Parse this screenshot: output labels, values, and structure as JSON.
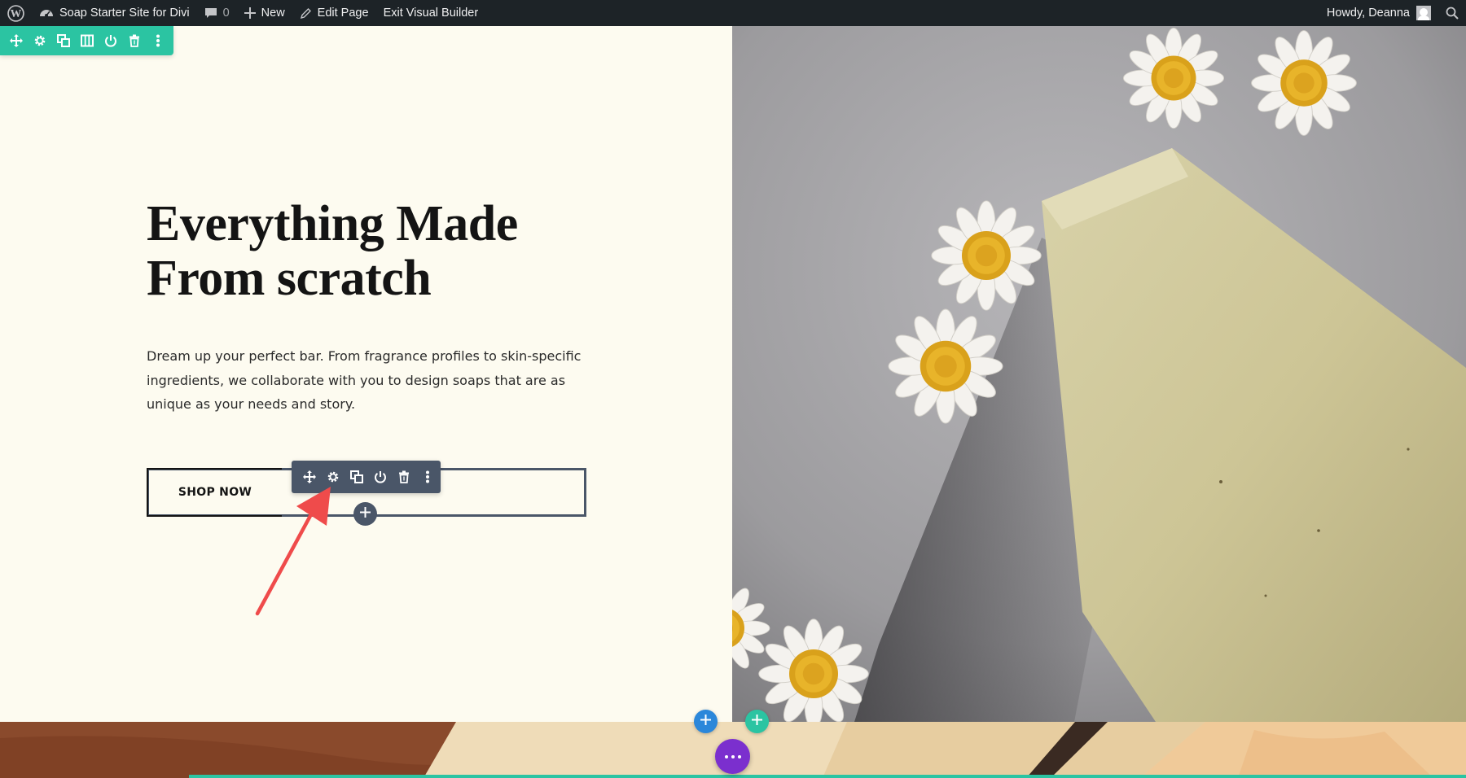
{
  "admin_bar": {
    "site_name": "Soap Starter Site for Divi",
    "comments_count": "0",
    "new_label": "New",
    "edit_page_label": "Edit Page",
    "exit_builder_label": "Exit Visual Builder",
    "greeting": "Howdy, Deanna"
  },
  "section_toolbar": {
    "icons": [
      "move-icon",
      "gear-icon",
      "duplicate-icon",
      "columns-icon",
      "power-icon",
      "trash-icon",
      "more-icon"
    ],
    "color": "#2bc4a2"
  },
  "hero": {
    "title_line1": "Everything Made",
    "title_line2": "From scratch",
    "body": "Dream up your perfect bar. From fragrance profiles to skin-specific ingredients, we collaborate with you to design soaps that are as unique as your needs and story.",
    "button_label": "SHOP NOW"
  },
  "module_toolbar": {
    "icons": [
      "move-icon",
      "gear-icon",
      "duplicate-icon",
      "power-icon",
      "trash-icon",
      "more-icon"
    ],
    "color": "#4a5668"
  },
  "builder_controls": {
    "add_section_color": "#2b87da",
    "add_row_color": "#2bc4a2",
    "page_settings_color": "#7b2fce"
  },
  "annotation": {
    "arrow_color": "#ef4b4b"
  }
}
